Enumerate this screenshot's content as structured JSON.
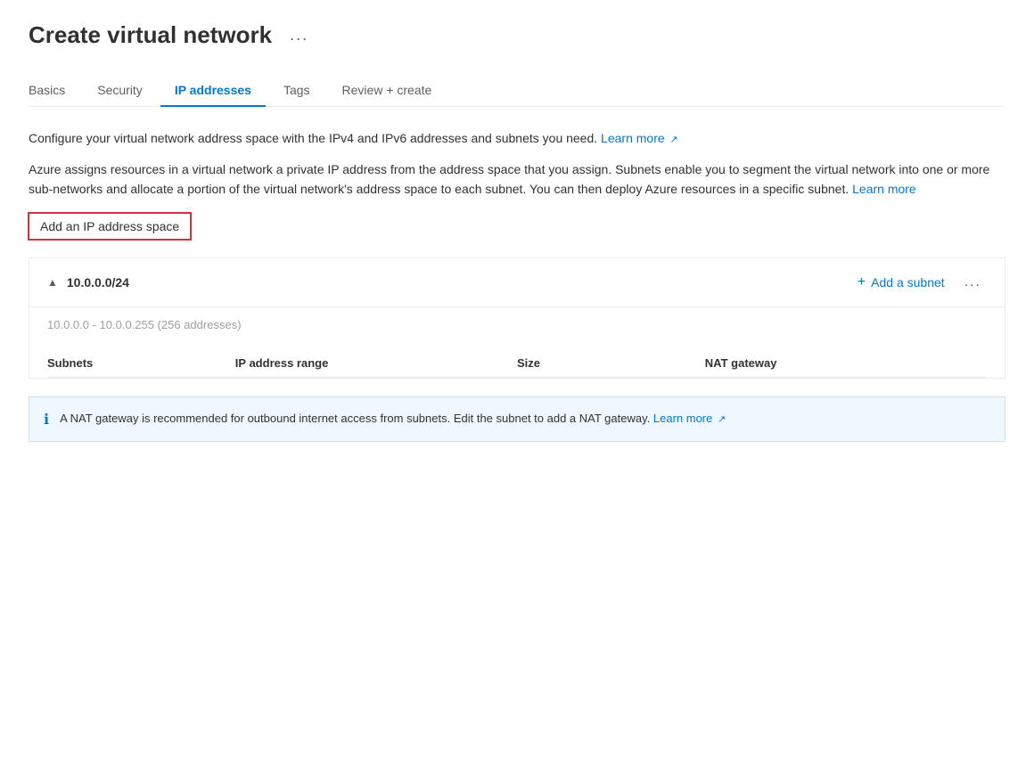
{
  "page": {
    "title": "Create virtual network",
    "ellipsis": "...",
    "tabs": [
      {
        "id": "basics",
        "label": "Basics",
        "active": false
      },
      {
        "id": "security",
        "label": "Security",
        "active": false
      },
      {
        "id": "ip-addresses",
        "label": "IP addresses",
        "active": true
      },
      {
        "id": "tags",
        "label": "Tags",
        "active": false
      },
      {
        "id": "review-create",
        "label": "Review + create",
        "active": false
      }
    ]
  },
  "content": {
    "description1": "Configure your virtual network address space with the IPv4 and IPv6 addresses and subnets you need.",
    "learn_more_1": "Learn more",
    "description2": "Azure assigns resources in a virtual network a private IP address from the address space that you assign. Subnets enable you to segment the virtual network into one or more sub-networks and allocate a portion of the virtual network's address space to each subnet. You can then deploy Azure resources in a specific subnet.",
    "learn_more_2": "Learn more",
    "add_ip_btn": "Add an IP address space",
    "ip_space": {
      "address": "10.0.0.0/24",
      "range_info": "10.0.0.0 - 10.0.0.255 (256 addresses)",
      "add_subnet_label": "Add a subnet",
      "more_options": "...",
      "table_headers": {
        "subnets": "Subnets",
        "ip_range": "IP address range",
        "size": "Size",
        "nat_gateway": "NAT gateway"
      }
    },
    "info_banner": {
      "text": "A NAT gateway is recommended for outbound internet access from subnets. Edit the subnet to add a NAT gateway.",
      "learn_more": "Learn more"
    }
  }
}
